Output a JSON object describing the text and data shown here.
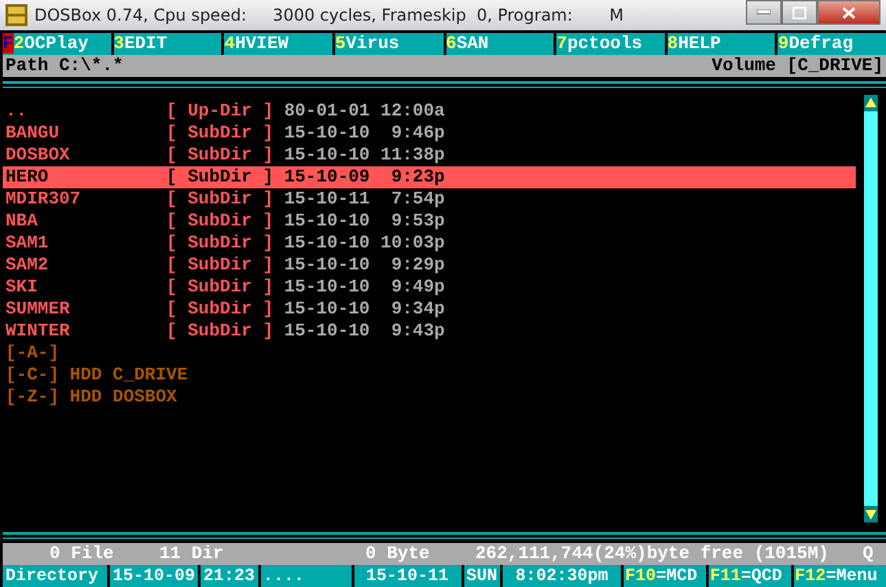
{
  "window": {
    "title": "DOSBox 0.74, Cpu speed:     3000 cycles, Frameskip  0, Program:       M"
  },
  "cursor": "F",
  "function_keys": [
    {
      "key": "2",
      "label": "OCPlay"
    },
    {
      "key": "3",
      "label": "EDIT"
    },
    {
      "key": "4",
      "label": "HVIEW"
    },
    {
      "key": "5",
      "label": "Virus"
    },
    {
      "key": "6",
      "label": "SAN"
    },
    {
      "key": "7",
      "label": "pctools"
    },
    {
      "key": "8",
      "label": "HELP"
    },
    {
      "key": "9",
      "label": "Defrag"
    }
  ],
  "path": "Path C:\\*.*",
  "volume": "Volume [C_DRIVE]",
  "files": [
    {
      "name": "..",
      "type": "[ Up-Dir ]",
      "date": "80-01-01",
      "time": "12:00a",
      "selected": false
    },
    {
      "name": "BANGU",
      "type": "[ SubDir ]",
      "date": "15-10-10",
      "time": "9:46p",
      "selected": false
    },
    {
      "name": "DOSBOX",
      "type": "[ SubDir ]",
      "date": "15-10-10",
      "time": "11:38p",
      "selected": false
    },
    {
      "name": "HERO",
      "type": "[ SubDir ]",
      "date": "15-10-09",
      "time": "9:23p",
      "selected": true
    },
    {
      "name": "MDIR307",
      "type": "[ SubDir ]",
      "date": "15-10-11",
      "time": "7:54p",
      "selected": false
    },
    {
      "name": "NBA",
      "type": "[ SubDir ]",
      "date": "15-10-10",
      "time": "9:53p",
      "selected": false
    },
    {
      "name": "SAM1",
      "type": "[ SubDir ]",
      "date": "15-10-10",
      "time": "10:03p",
      "selected": false
    },
    {
      "name": "SAM2",
      "type": "[ SubDir ]",
      "date": "15-10-10",
      "time": "9:29p",
      "selected": false
    },
    {
      "name": "SKI",
      "type": "[ SubDir ]",
      "date": "15-10-10",
      "time": "9:49p",
      "selected": false
    },
    {
      "name": "SUMMER",
      "type": "[ SubDir ]",
      "date": "15-10-10",
      "time": "9:34p",
      "selected": false
    },
    {
      "name": "WINTER",
      "type": "[ SubDir ]",
      "date": "15-10-10",
      "time": "9:43p",
      "selected": false
    }
  ],
  "drives": [
    "[-A-]",
    "[-C-] HDD C_DRIVE",
    "[-Z-] HDD DOSBOX"
  ],
  "summary": {
    "files": "0 File",
    "dirs": "11 Dir",
    "bytes": "0 Byte",
    "free": "262,111,744(24%)byte free (1015M)",
    "column_5": "Q"
  },
  "status_bar": [
    {
      "text": "Directory"
    },
    {
      "text": "15-10-09"
    },
    {
      "text": "21:23"
    },
    {
      "text": "...."
    },
    {
      "text": "15-10-11"
    },
    {
      "text": "SUN"
    },
    {
      "text": "8:02:30pm"
    }
  ],
  "shortcuts": [
    {
      "key": "F10",
      "label": "=MCD"
    },
    {
      "key": "F11",
      "label": "=QCD"
    },
    {
      "key": "F12",
      "label": "=Menu"
    }
  ]
}
